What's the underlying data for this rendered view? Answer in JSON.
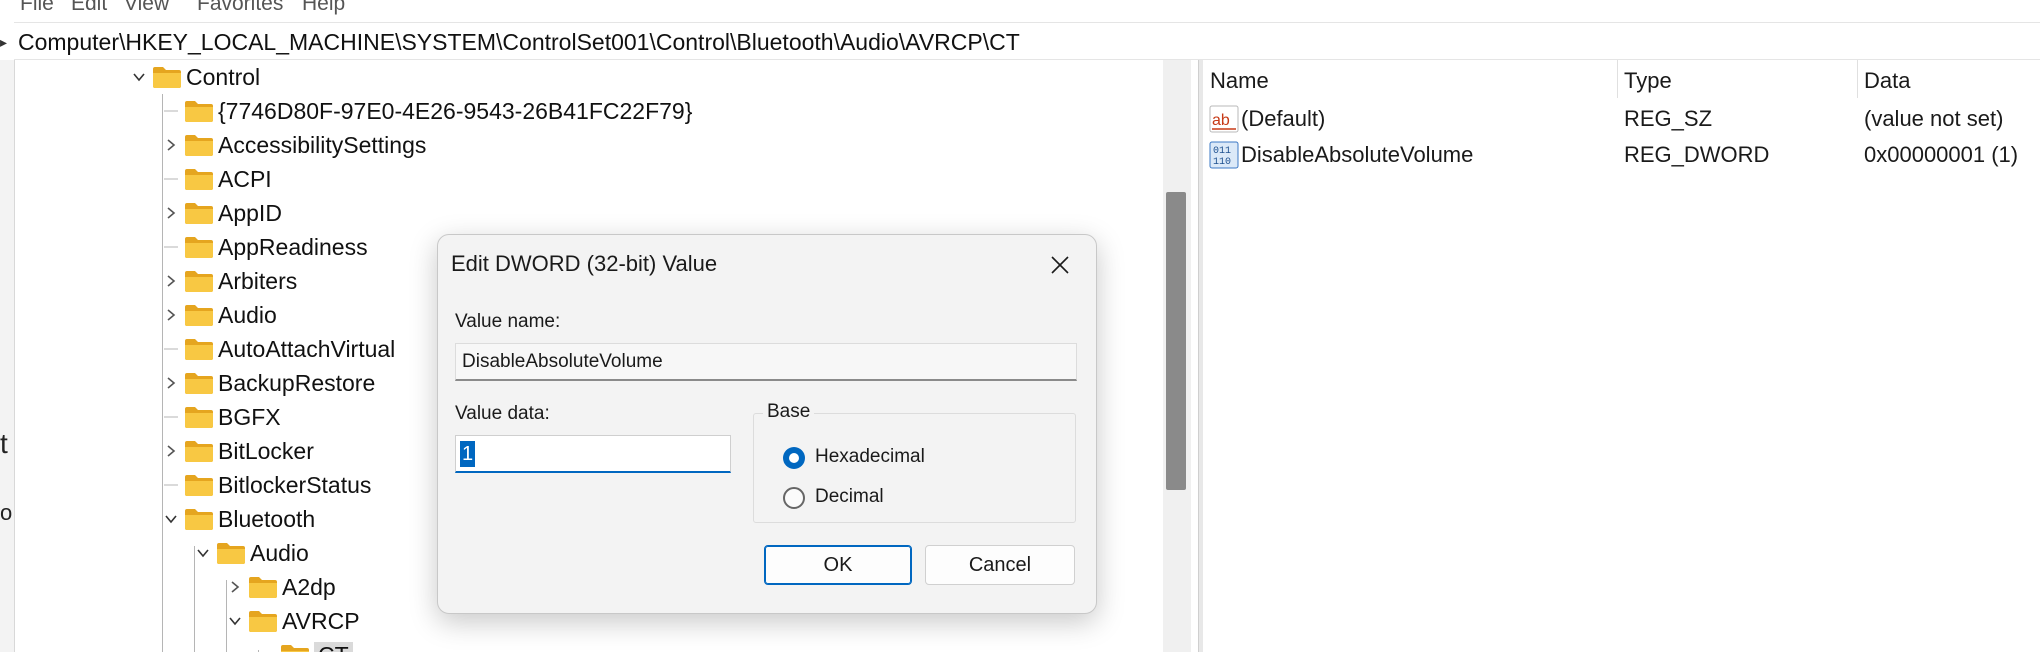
{
  "menu": {
    "items": [
      "File",
      "Edit",
      "View",
      "Favorites",
      "Help"
    ]
  },
  "address": {
    "path": "Computer\\HKEY_LOCAL_MACHINE\\SYSTEM\\ControlSet001\\Control\\Bluetooth\\Audio\\AVRCP\\CT"
  },
  "left_fragments": {
    "a": "t",
    "b": "o"
  },
  "tree": {
    "nodes": [
      {
        "label": "Control",
        "expanded": true
      },
      {
        "label": "{7746D80F-97E0-4E26-9543-26B41FC22F79}"
      },
      {
        "label": "AccessibilitySettings"
      },
      {
        "label": "ACPI"
      },
      {
        "label": "AppID"
      },
      {
        "label": "AppReadiness"
      },
      {
        "label": "Arbiters"
      },
      {
        "label": "Audio"
      },
      {
        "label": "AutoAttachVirtual"
      },
      {
        "label": "BackupRestore"
      },
      {
        "label": "BGFX"
      },
      {
        "label": "BitLocker"
      },
      {
        "label": "BitlockerStatus"
      },
      {
        "label": "Bluetooth",
        "expanded": true
      },
      {
        "label": "Audio",
        "expanded": true
      },
      {
        "label": "A2dp"
      },
      {
        "label": "AVRCP",
        "expanded": true
      },
      {
        "label": "CT",
        "selected": true
      }
    ]
  },
  "values": {
    "columns": {
      "name": "Name",
      "type": "Type",
      "data": "Data"
    },
    "rows": [
      {
        "name": "(Default)",
        "type": "REG_SZ",
        "data": "(value not set)",
        "icon": "string-value-icon"
      },
      {
        "name": "DisableAbsoluteVolume",
        "type": "REG_DWORD",
        "data": "0x00000001 (1)",
        "icon": "binary-value-icon"
      }
    ]
  },
  "dialog": {
    "title": "Edit DWORD (32-bit) Value",
    "value_name_label": "Value name:",
    "value_name": "DisableAbsoluteVolume",
    "value_data_label": "Value data:",
    "value_data": "1",
    "base_label": "Base",
    "base_options": [
      {
        "label": "Hexadecimal",
        "selected": true
      },
      {
        "label": "Decimal",
        "selected": false
      }
    ],
    "ok_label": "OK",
    "cancel_label": "Cancel"
  },
  "colors": {
    "accent": "#0067c0",
    "folder": "#f8c843",
    "folder_dark": "#e5a51f"
  }
}
